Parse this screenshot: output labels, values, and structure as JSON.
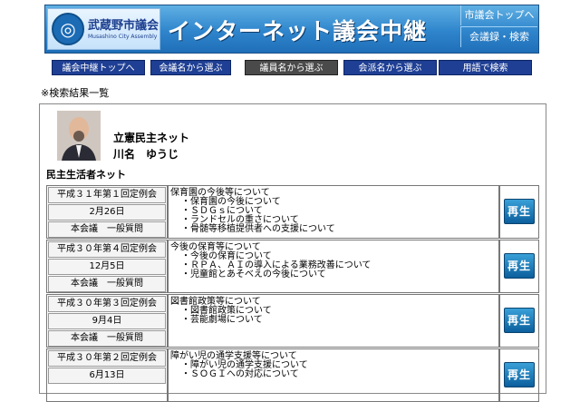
{
  "header": {
    "city_name": "武蔵野市議会",
    "city_name_en": "Musashino City Assembly",
    "site_title": "インターネット議会中継",
    "link_top": "市議会トップへ",
    "link_search": "会議録・検索"
  },
  "nav": [
    {
      "label": "議会中継トップへ",
      "selected": false
    },
    {
      "label": "会議名から選ぶ",
      "selected": false
    },
    {
      "label": "議員名から選ぶ",
      "selected": true
    },
    {
      "label": "会派名から選ぶ",
      "selected": false
    },
    {
      "label": "用語で検索",
      "selected": false
    }
  ],
  "results_heading": "※検索結果一覧",
  "member": {
    "party": "立憲民主ネット",
    "name": "川名　ゆうじ",
    "group": "民主生活者ネット"
  },
  "play_label": "再生",
  "rows": [
    {
      "session": "平成３１年第１回定例会",
      "date": "2月26日",
      "type": "本会議　一般質問",
      "topic": "保育園の今後等について",
      "subs": [
        "・保育園の今後について",
        "・ＳＤＧｓについて",
        "・ランドセルの重さについて",
        "・骨髄等移植提供者への支援について"
      ]
    },
    {
      "session": "平成３０年第４回定例会",
      "date": "12月5日",
      "type": "本会議　一般質問",
      "topic": "今後の保育等について",
      "subs": [
        "・今後の保育について",
        "・ＲＰＡ、ＡＩの導入による業務改善について",
        "・児童館とあそべえの今後について"
      ]
    },
    {
      "session": "平成３０年第３回定例会",
      "date": "9月4日",
      "type": "本会議　一般質問",
      "topic": "図書館政策等について",
      "subs": [
        "・図書館政策について",
        "・芸能劇場について"
      ]
    },
    {
      "session": "平成３０年第２回定例会",
      "date": "6月13日",
      "type": "",
      "topic": "障がい児の通学支援等について",
      "subs": [
        "・障がい児の通学支援について",
        "・ＳＯＧＩへの対応について"
      ]
    }
  ]
}
